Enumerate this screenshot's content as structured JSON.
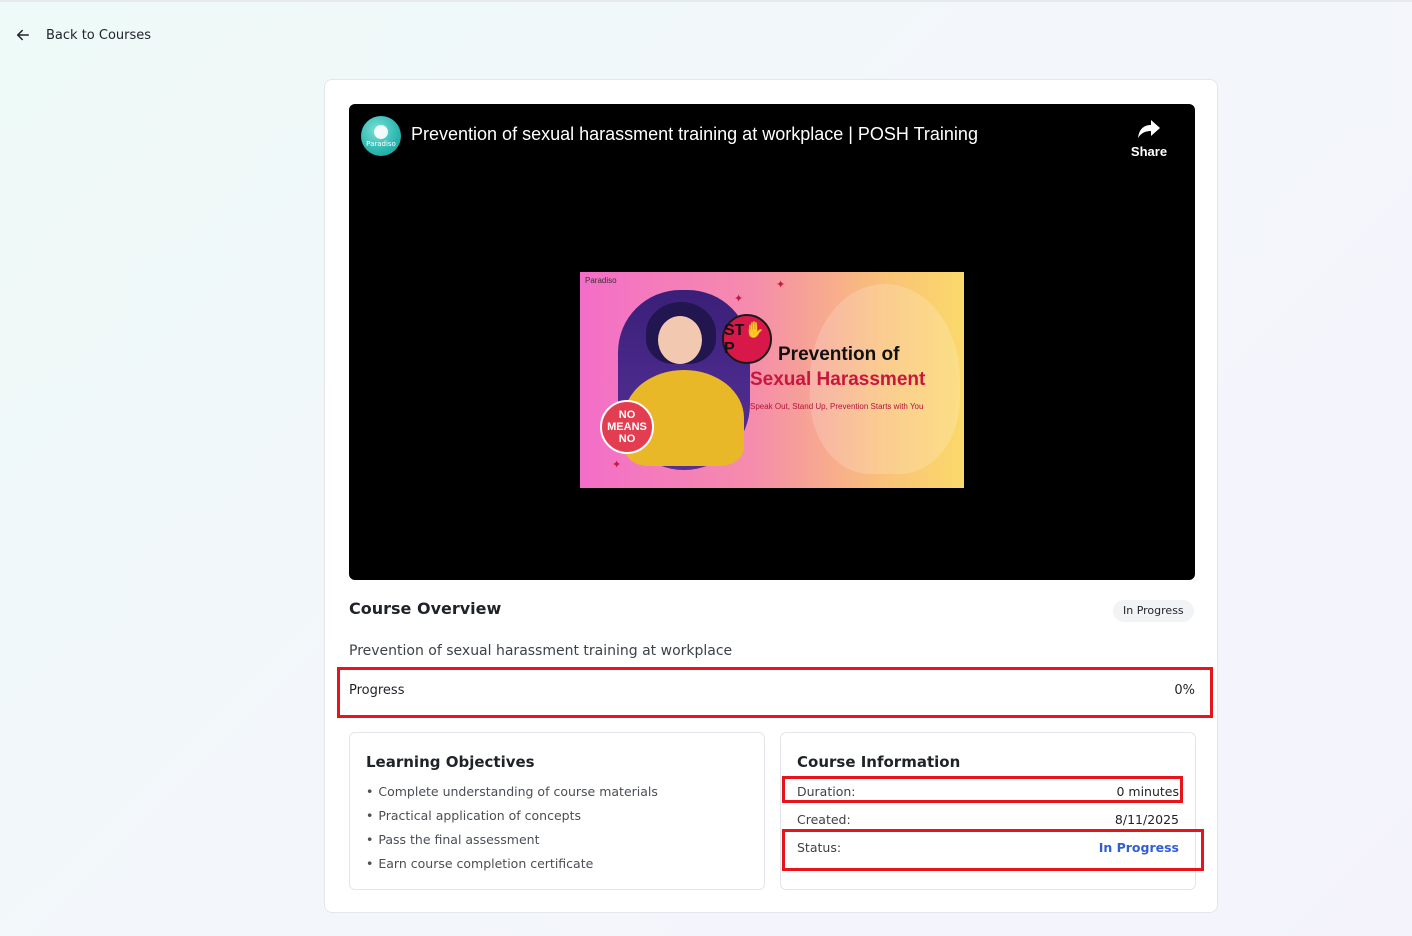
{
  "nav": {
    "back_label": "Back to Courses",
    "back_icon": "arrow-left-icon"
  },
  "video": {
    "channel_logo_text": "Paradiso",
    "title": "Prevention of sexual harassment training at workplace | POSH Training",
    "share_label": "Share",
    "share_icon": "share-arrow-icon",
    "thumbnail": {
      "brand": "Paradiso",
      "stop_text": "ST✋P",
      "no_means_no": "NO MEANS NO",
      "title_line1": "Prevention of",
      "title_line2": "Sexual Harassment",
      "tagline": "Speak Out, Stand Up, Prevention Starts with You"
    }
  },
  "overview": {
    "title": "Course Overview",
    "status_badge": "In Progress",
    "description": "Prevention of sexual harassment training at workplace",
    "progress_label": "Progress",
    "progress_value": "0%"
  },
  "objectives": {
    "title": "Learning Objectives",
    "items": [
      "Complete understanding of course materials",
      "Practical application of concepts",
      "Pass the final assessment",
      "Earn course completion certificate"
    ]
  },
  "info": {
    "title": "Course Information",
    "duration_label": "Duration:",
    "duration_value": "0 minutes",
    "created_label": "Created:",
    "created_value": "8/11/2025",
    "status_label": "Status:",
    "status_value": "In Progress"
  },
  "colors": {
    "highlight": "#e8141b",
    "status_blue": "#2f5fd4",
    "video_bg": "#000000"
  }
}
